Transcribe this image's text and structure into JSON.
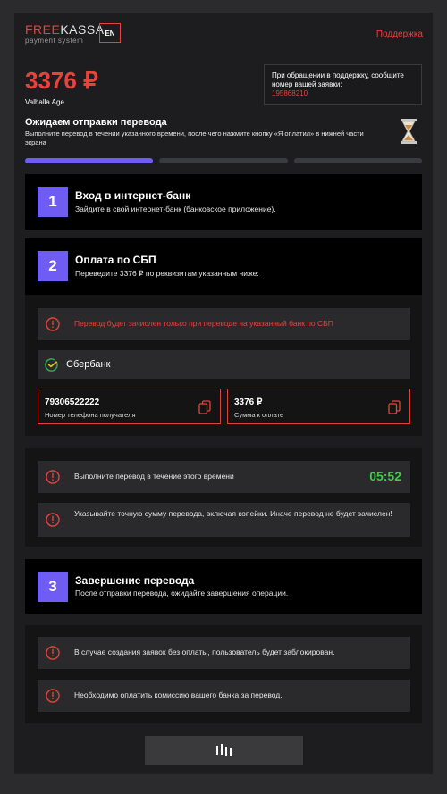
{
  "header": {
    "logo_part1": "FREE",
    "logo_part2": "KASSA",
    "logo_sub": "payment system",
    "lang": "EN",
    "support_label": "Поддержка"
  },
  "payment": {
    "amount": "3376 ₽",
    "merchant": "Valhalla Age"
  },
  "support_box": {
    "text": "При обращении в поддержку, сообщите номер вашей заявки:",
    "order_number": "195868210"
  },
  "status": {
    "title": "Ожидаем отправки перевода",
    "description": "Выполните перевод в течении указанного времени, после чего нажмите кнопку «Я оплатил» в нижней части экрана",
    "progress_steps": 3,
    "progress_active": 1
  },
  "steps": [
    {
      "number": "1",
      "title": "Вход в интернет-банк",
      "description": "Зайдите в свой интернет-банк (банковское приложение)."
    },
    {
      "number": "2",
      "title": "Оплата по СБП",
      "description": "Переведите 3376 ₽ по реквизитам указанным ниже:"
    },
    {
      "number": "3",
      "title": "Завершение перевода",
      "description": "После отправки перевода, ожидайте завершения операции."
    }
  ],
  "sbp": {
    "warning": "Перевод будет зачислен только при переводе на указанный банк по СБП",
    "bank_name": "Сбербанк",
    "phone_value": "79306522222",
    "phone_label": "Номер телефона получателя",
    "sum_value": "3376 ₽",
    "sum_label": "Сумма к оплате"
  },
  "timer_panel": {
    "time_notice": "Выполните перевод в течение этого времени",
    "timer": "05:52",
    "exact_sum_notice": "Указывайте точную сумму перевода, включая копейки. Иначе перевод не будет зачислен!"
  },
  "final_notices": {
    "block_notice": "В случае создания заявок без оплаты, пользователь будет заблокирован.",
    "fee_notice": "Необходимо оплатить комиссию вашего банка за перевод."
  },
  "colors": {
    "accent_red": "#e8423b",
    "accent_purple": "#6f5cf4",
    "timer_green": "#43c74e"
  },
  "icons": {
    "warning": "exclamation-circle-icon",
    "copy": "copy-icon",
    "loader": "loading-bars-icon",
    "hourglass": "hourglass-icon",
    "bank": "sberbank-logo-icon"
  }
}
